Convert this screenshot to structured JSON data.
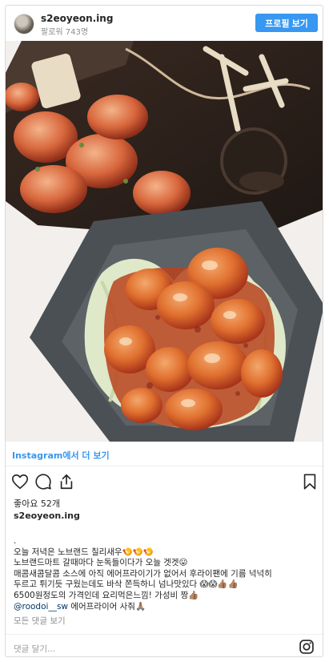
{
  "header": {
    "username": "s2eoyeon.ing",
    "followers": "팔로워 743명",
    "profile_button": "프로필 보기"
  },
  "view_more": "Instagram에서 더 보기",
  "likes": "좋아요 52개",
  "poster": "s2eoyeon.ing",
  "caption": {
    "dot": ".",
    "line1": "오늘 저녁은 노브랜드 칠리새우🍤🍤🍤",
    "line2": "노브랜드마트 갈때마다 눈독들이다가 오늘 겟겟😛",
    "line3": "매콤새콤달콤 소스에 아직 에어프라이기가 없어서 후라이팬에 기름 넉넉히",
    "line4": "두르고 튀기듯 구웠는데도 바삭 쫀득하니 넘나맛있다 😱😱👍🏽👍🏽",
    "line5": "6500원정도의 가격인데 요리먹은느낌! 가성비 짱👍🏽",
    "mention": "@roodoi__sw",
    "line6_rest": " 에어프라이어 사줘🙏🏽"
  },
  "view_comments": "모든 댓글 보기",
  "comment_placeholder": "댓글 달기...",
  "icons": {
    "like": "heart-icon",
    "comment": "speech-bubble-icon",
    "share": "share-icon",
    "save": "bookmark-icon",
    "instagram": "instagram-logo-icon"
  },
  "colors": {
    "accent": "#3897f0",
    "text": "#262626",
    "muted": "#8e8e8e"
  }
}
